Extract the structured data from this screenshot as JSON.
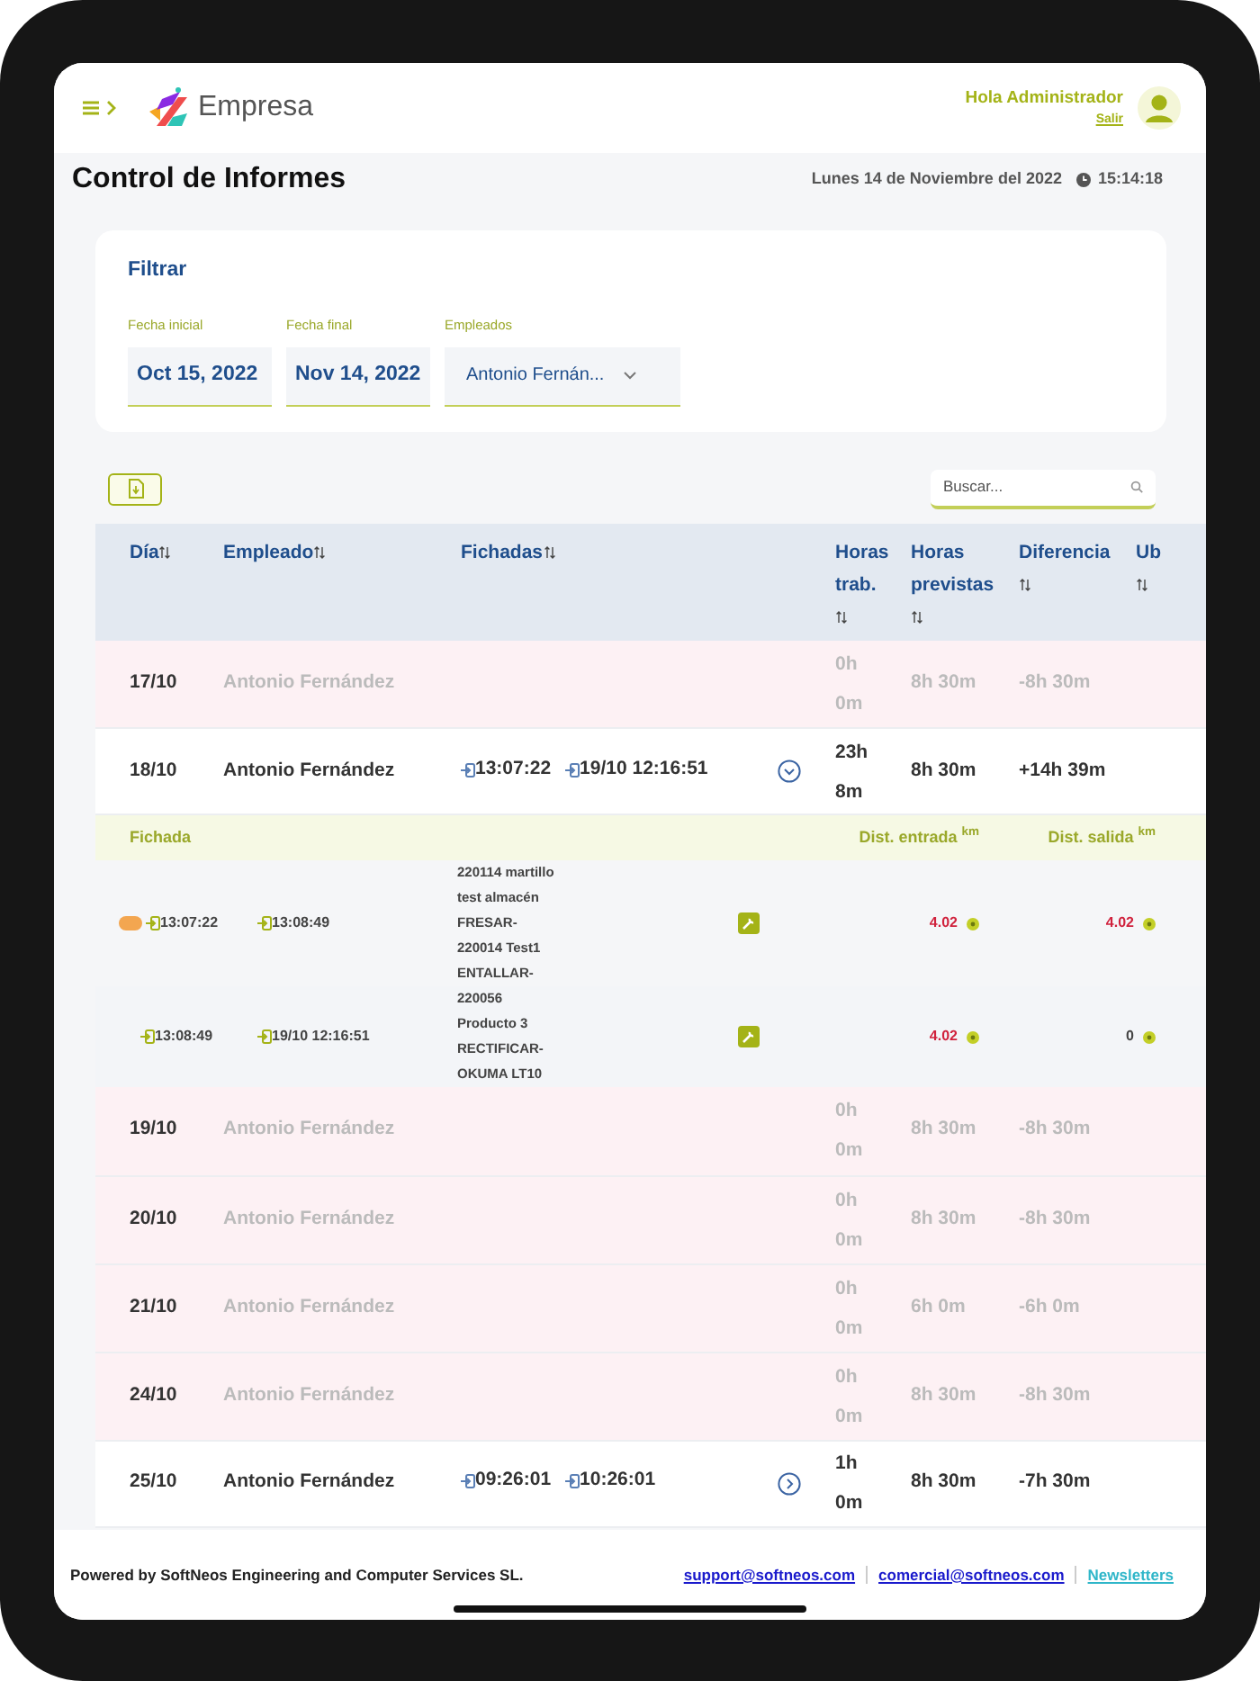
{
  "header": {
    "brand": "Empresa",
    "greeting": "Hola Administrador",
    "logout": "Salir"
  },
  "page": {
    "title": "Control de Informes",
    "date": "Lunes 14 de Noviembre del 2022",
    "time": "15:14:18"
  },
  "filter": {
    "title": "Filtrar",
    "fields": [
      {
        "label": "Fecha inicial",
        "value": "Oct 15, 2022",
        "kind": "date"
      },
      {
        "label": "Fecha final",
        "value": "Nov 14, 2022",
        "kind": "date"
      },
      {
        "label": "Empleados",
        "value": "Antonio Fernán...",
        "kind": "select"
      }
    ]
  },
  "search": {
    "placeholder": "Buscar..."
  },
  "table": {
    "columns": [
      "Día",
      "Empleado",
      "Fichadas",
      "Horas trab.",
      "Horas previstas",
      "Diferencia",
      "Ub"
    ],
    "rows": [
      {
        "day": "17/10",
        "employee": "Antonio Fernández",
        "absent": true,
        "punches": [],
        "worked": "0h 0m",
        "planned": "8h 30m",
        "difference": "-8h 30m"
      },
      {
        "day": "18/10",
        "employee": "Antonio Fernández",
        "absent": false,
        "punches": [
          "13:07:22",
          "19/10 12:16:51"
        ],
        "expanded": true,
        "worked": "23h 8m",
        "planned": "8h 30m",
        "difference": "+14h 39m",
        "detail": {
          "columns": [
            {
              "label": "Fichada"
            },
            {
              "label": "Dist. entrada",
              "unit": "km"
            },
            {
              "label": "Dist. salida",
              "unit": "km"
            }
          ],
          "rows": [
            {
              "badge": true,
              "in": "13:07:22",
              "out": "13:08:49",
              "lines": [
                "220114 martillo",
                "test almacén",
                "FRESAR-",
                "220014 Test1",
                "ENTALLAR-"
              ],
              "dist_in": "4.02",
              "dist_in_alert": true,
              "dist_out": "4.02",
              "dist_out_alert": true
            },
            {
              "badge": false,
              "in": "13:08:49",
              "out": "19/10 12:16:51",
              "lines": [
                "220056",
                "Producto 3",
                "RECTIFICAR-",
                "OKUMA LT10"
              ],
              "dist_in": "4.02",
              "dist_in_alert": true,
              "dist_out": "0",
              "dist_out_alert": false
            }
          ]
        }
      },
      {
        "day": "19/10",
        "employee": "Antonio Fernández",
        "absent": true,
        "punches": [],
        "worked": "0h 0m",
        "planned": "8h 30m",
        "difference": "-8h 30m"
      },
      {
        "day": "20/10",
        "employee": "Antonio Fernández",
        "absent": true,
        "punches": [],
        "worked": "0h 0m",
        "planned": "8h 30m",
        "difference": "-8h 30m"
      },
      {
        "day": "21/10",
        "employee": "Antonio Fernández",
        "absent": true,
        "punches": [],
        "worked": "0h 0m",
        "planned": "6h 0m",
        "difference": "-6h 0m"
      },
      {
        "day": "24/10",
        "employee": "Antonio Fernández",
        "absent": true,
        "punches": [],
        "worked": "0h 0m",
        "planned": "8h 30m",
        "difference": "-8h 30m"
      },
      {
        "day": "25/10",
        "employee": "Antonio Fernández",
        "absent": false,
        "punches": [
          "09:26:01",
          "10:26:01"
        ],
        "expanded": false,
        "worked": "1h 0m",
        "planned": "8h 30m",
        "difference": "-7h 30m"
      }
    ]
  },
  "footer": {
    "text": "Powered by SoftNeos Engineering and Computer Services SL.",
    "links": [
      "support@softneos.com",
      "comercial@softneos.com",
      "Newsletters"
    ]
  }
}
